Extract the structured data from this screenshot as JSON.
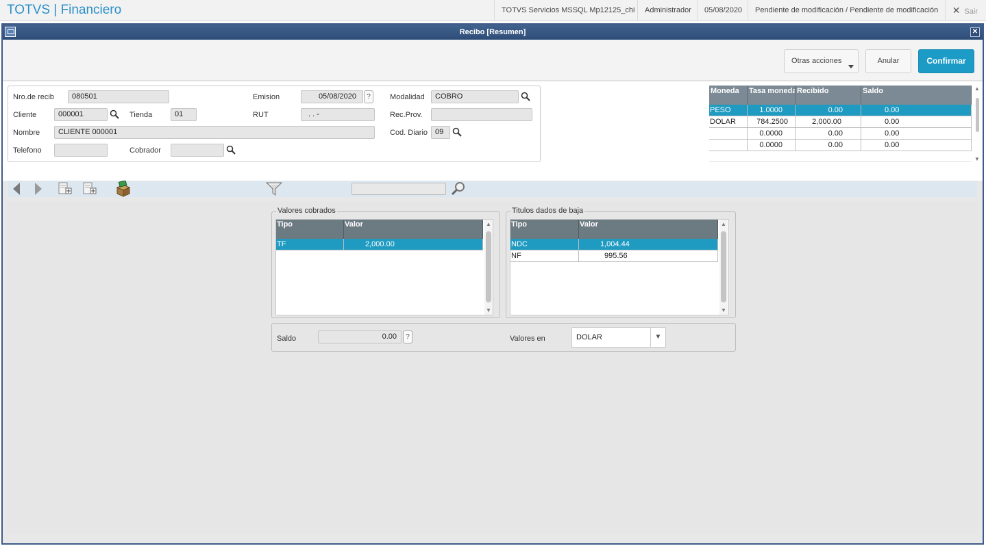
{
  "topbar": {
    "app_title": "TOTVS | Financiero",
    "environment": "TOTVS Servicios MSSQL Mp12125_chi",
    "user": "Administrador",
    "date": "05/08/2020",
    "status": "Pendiente de modificación / Pendiente de modificación",
    "exit_label": "Sair"
  },
  "window": {
    "title": "Recibo [Resumen]"
  },
  "actions": {
    "more_label": "Otras acciones",
    "cancel_label": "Anular",
    "confirm_label": "Confirmar"
  },
  "form": {
    "nro_recib_label": "Nro.de recib",
    "nro_recib_value": "080501",
    "emision_label": "Emision",
    "emision_value": "05/08/2020",
    "modalidad_label": "Modalidad",
    "modalidad_value": "COBRO",
    "cliente_label": "Cliente",
    "cliente_value": "000001",
    "tienda_label": "Tienda",
    "tienda_value": "01",
    "rut_label": "RUT",
    "rut_value": ". . -",
    "recprov_label": "Rec.Prov.",
    "recprov_value": "",
    "nombre_label": "Nombre",
    "nombre_value": "CLIENTE 000001",
    "coddiario_label": "Cod. Diario",
    "coddiario_value": "09",
    "telefono_label": "Telefono",
    "telefono_value": "",
    "cobrador_label": "Cobrador",
    "cobrador_value": "",
    "help_mark": "?"
  },
  "currency_table": {
    "headers": [
      "Moneda",
      "Tasa moneda",
      "Recibido",
      "Saldo"
    ],
    "rows": [
      {
        "moneda": "PESO",
        "tasa": "1.0000",
        "recibido": "0.00",
        "saldo": "0.00"
      },
      {
        "moneda": "DOLAR",
        "tasa": "784.2500",
        "recibido": "2,000.00",
        "saldo": "0.00"
      },
      {
        "moneda": "",
        "tasa": "0.0000",
        "recibido": "0.00",
        "saldo": "0.00"
      },
      {
        "moneda": "",
        "tasa": "0.0000",
        "recibido": "0.00",
        "saldo": "0.00"
      }
    ]
  },
  "valores_cobrados": {
    "title": "Valores cobrados",
    "headers": [
      "Tipo",
      "Valor"
    ],
    "rows": [
      {
        "tipo": "TF",
        "valor": "2,000.00"
      }
    ]
  },
  "titulos_baja": {
    "title": "Titulos dados de baja",
    "headers": [
      "Tipo",
      "Valor"
    ],
    "rows": [
      {
        "tipo": "NDC",
        "valor": "1,004.44"
      },
      {
        "tipo": "NF",
        "valor": "995.56"
      }
    ]
  },
  "summary": {
    "saldo_label": "Saldo",
    "saldo_value": "0.00",
    "valores_en_label": "Valores en",
    "valores_en_value": "DOLAR"
  },
  "colors": {
    "brand": "#2a8fc8",
    "confirm": "#1b9bc6",
    "selection": "#1f9ac1",
    "titlebar": "#2e4c78"
  }
}
